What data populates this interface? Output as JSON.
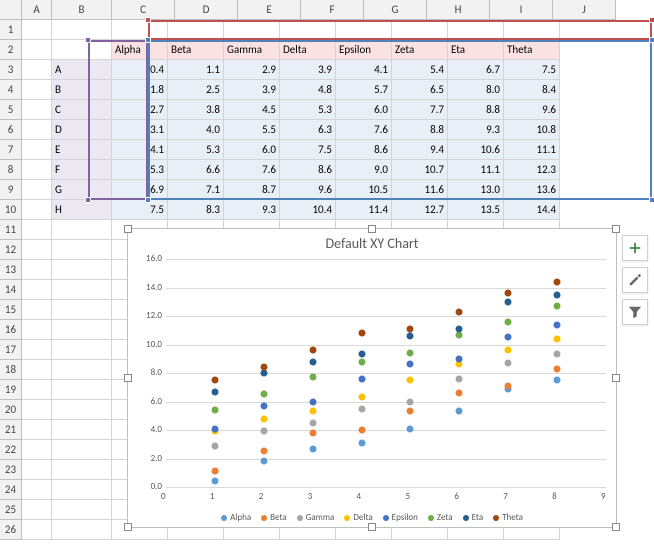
{
  "columns": [
    "",
    "A",
    "B",
    "C",
    "D",
    "E",
    "F",
    "G",
    "H",
    "I",
    "J"
  ],
  "row_numbers": [
    1,
    2,
    3,
    4,
    5,
    6,
    7,
    8,
    9,
    10,
    11,
    12,
    13,
    14,
    15,
    16,
    17,
    18,
    19,
    20,
    21,
    22,
    23,
    24,
    25,
    26
  ],
  "series_headers": [
    "Alpha",
    "Beta",
    "Gamma",
    "Delta",
    "Epsilon",
    "Zeta",
    "Eta",
    "Theta"
  ],
  "category_labels": [
    "A",
    "B",
    "C",
    "D",
    "E",
    "F",
    "G",
    "H"
  ],
  "table": [
    [
      0.4,
      1.1,
      2.9,
      3.9,
      4.1,
      5.4,
      6.7,
      7.5
    ],
    [
      1.8,
      2.5,
      3.9,
      4.8,
      5.7,
      6.5,
      8.0,
      8.4
    ],
    [
      2.7,
      3.8,
      4.5,
      5.3,
      6.0,
      7.7,
      8.8,
      9.6
    ],
    [
      3.1,
      4.0,
      5.5,
      6.3,
      7.6,
      8.8,
      9.3,
      10.8
    ],
    [
      4.1,
      5.3,
      6.0,
      7.5,
      8.6,
      9.4,
      10.6,
      11.1
    ],
    [
      5.3,
      6.6,
      7.6,
      8.6,
      9.0,
      10.7,
      11.1,
      12.3
    ],
    [
      6.9,
      7.1,
      8.7,
      9.6,
      10.5,
      11.6,
      13.0,
      13.6
    ],
    [
      7.5,
      8.3,
      9.3,
      10.4,
      11.4,
      12.7,
      13.5,
      14.4
    ]
  ],
  "chart_data": {
    "type": "scatter",
    "title": "Default XY Chart",
    "xlabel": "",
    "ylabel": "",
    "xlim": [
      0,
      9
    ],
    "ylim": [
      0,
      16
    ],
    "xticks": [
      0,
      1,
      2,
      3,
      4,
      5,
      6,
      7,
      8,
      9
    ],
    "yticks": [
      0.0,
      2.0,
      4.0,
      6.0,
      8.0,
      10.0,
      12.0,
      14.0,
      16.0
    ],
    "x": [
      1,
      2,
      3,
      4,
      5,
      6,
      7,
      8
    ],
    "series": [
      {
        "name": "Alpha",
        "color": "#5b9bd5",
        "values": [
          0.4,
          1.8,
          2.7,
          3.1,
          4.1,
          5.3,
          6.9,
          7.5
        ]
      },
      {
        "name": "Beta",
        "color": "#ed7d31",
        "values": [
          1.1,
          2.5,
          3.8,
          4.0,
          5.3,
          6.6,
          7.1,
          8.3
        ]
      },
      {
        "name": "Gamma",
        "color": "#a5a5a5",
        "values": [
          2.9,
          3.9,
          4.5,
          5.5,
          6.0,
          7.6,
          8.7,
          9.3
        ]
      },
      {
        "name": "Delta",
        "color": "#ffc000",
        "values": [
          3.9,
          4.8,
          5.3,
          6.3,
          7.5,
          8.6,
          9.6,
          10.4
        ]
      },
      {
        "name": "Epsilon",
        "color": "#4472c4",
        "values": [
          4.1,
          5.7,
          6.0,
          7.6,
          8.6,
          9.0,
          10.5,
          11.4
        ]
      },
      {
        "name": "Zeta",
        "color": "#70ad47",
        "values": [
          5.4,
          6.5,
          7.7,
          8.8,
          9.4,
          10.7,
          11.6,
          12.7
        ]
      },
      {
        "name": "Eta",
        "color": "#255e91",
        "values": [
          6.7,
          8.0,
          8.8,
          9.3,
          10.6,
          11.1,
          13.0,
          13.5
        ]
      },
      {
        "name": "Theta",
        "color": "#9e480e",
        "values": [
          7.5,
          8.4,
          9.6,
          10.8,
          11.1,
          12.3,
          13.6,
          14.4
        ]
      }
    ]
  },
  "side_buttons": {
    "plus": "chart-elements",
    "brush": "chart-styles",
    "funnel": "chart-filters"
  }
}
